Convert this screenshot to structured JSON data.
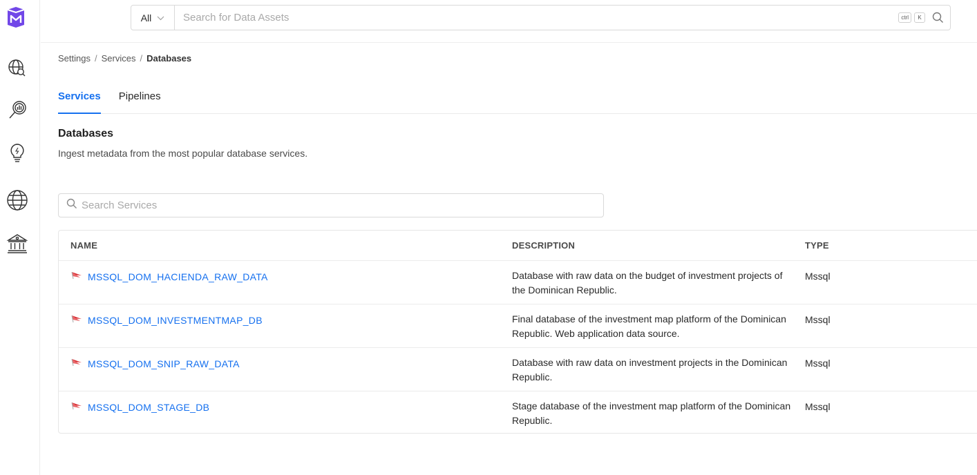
{
  "header": {
    "scope_label": "All",
    "search_placeholder": "Search for Data Assets",
    "shortcut_keys": [
      "ctrl",
      "K"
    ]
  },
  "rail": {
    "items": [
      "explore-icon",
      "data-insights-icon",
      "observability-icon",
      "domains-icon",
      "governance-icon"
    ]
  },
  "breadcrumb": {
    "items": [
      "Settings",
      "Services",
      "Databases"
    ],
    "separator": "/"
  },
  "tabs": [
    {
      "label": "Services",
      "active": true
    },
    {
      "label": "Pipelines",
      "active": false
    }
  ],
  "section": {
    "title": "Databases",
    "subtitle": "Ingest metadata from the most popular database services."
  },
  "service_search": {
    "placeholder": "Search Services"
  },
  "table": {
    "columns": [
      "NAME",
      "DESCRIPTION",
      "TYPE"
    ],
    "rows": [
      {
        "name": "MSSQL_DOM_HACIENDA_RAW_DATA",
        "description": "Database with raw data on the budget of investment projects of the Dominican Republic.",
        "type": "Mssql"
      },
      {
        "name": "MSSQL_DOM_INVESTMENTMAP_DB",
        "description": "Final database of the investment map platform of the Dominican Republic. Web application data source.",
        "type": "Mssql"
      },
      {
        "name": "MSSQL_DOM_SNIP_RAW_DATA",
        "description": "Database with raw data on investment projects in the Dominican Republic.",
        "type": "Mssql"
      },
      {
        "name": "MSSQL_DOM_STAGE_DB",
        "description": "Stage database of the investment map platform of the Dominican Republic.",
        "type": "Mssql"
      }
    ]
  },
  "colors": {
    "accent": "#1570ef",
    "brand": "#7147e8",
    "mssql_icon": "#d7262b"
  }
}
